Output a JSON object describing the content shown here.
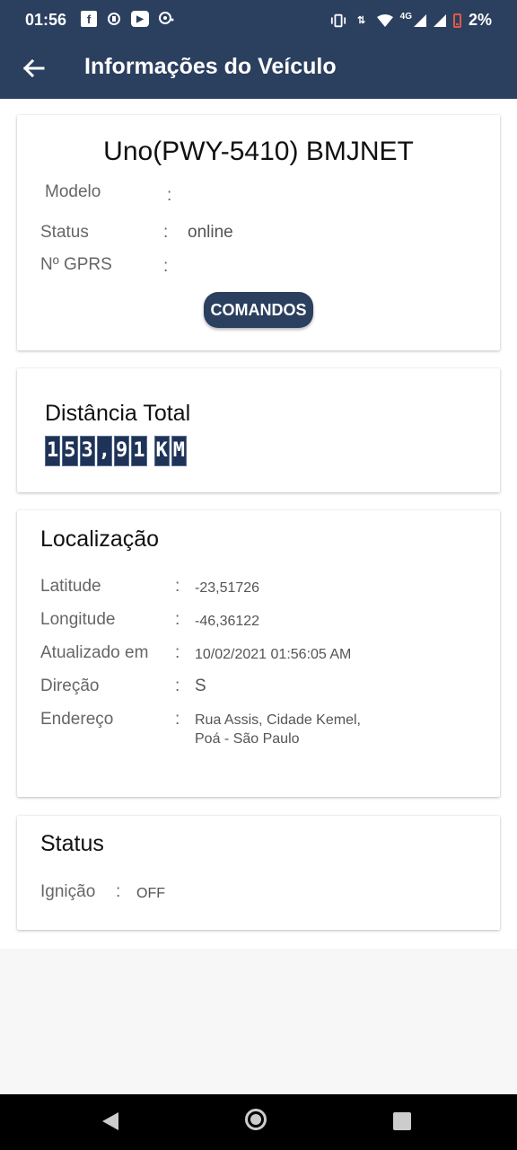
{
  "status_bar": {
    "time": "01:56",
    "network": "4G",
    "battery": "2%",
    "battery_level": 0.02,
    "icons": [
      "facebook-icon",
      "whatsapp-icon",
      "youtube-icon",
      "notification-icon",
      "vibrate-icon",
      "data-transfer-icon",
      "wifi-icon",
      "signal-icon",
      "battery-icon"
    ]
  },
  "app_bar": {
    "title": "Informações do Veículo",
    "back_icon": "arrow-left-icon"
  },
  "vehicle_card": {
    "name": "Uno(PWY-5410) BMJNET",
    "modelo_label": "Modelo",
    "modelo_value": "",
    "status_label": "Status",
    "status_value": "online",
    "gprs_label": "Nº GPRS",
    "gprs_value": "",
    "separator": ":",
    "commands_button": "COMANDOS"
  },
  "distance_card": {
    "title": "Distância Total",
    "odometer": "153,91 KM"
  },
  "location_card": {
    "title": "Localização",
    "latitude_label": "Latitude",
    "latitude_value": "-23,51726",
    "longitude_label": "Longitude",
    "longitude_value": "-46,36122",
    "updated_label": "Atualizado em",
    "updated_value": "10/02/2021 01:56:05 AM",
    "direction_label": "Direção",
    "direction_value": "S",
    "address_label": "Endereço",
    "address_line1": "Rua Assis, Cidade Kemel,",
    "address_line2": "Poá - São Paulo"
  },
  "status_card": {
    "title": "Status",
    "ignition_label": "Ignição",
    "ignition_value": "OFF"
  },
  "colors": {
    "primary": "#2b3f5f",
    "battery_low": "#e05a45"
  }
}
